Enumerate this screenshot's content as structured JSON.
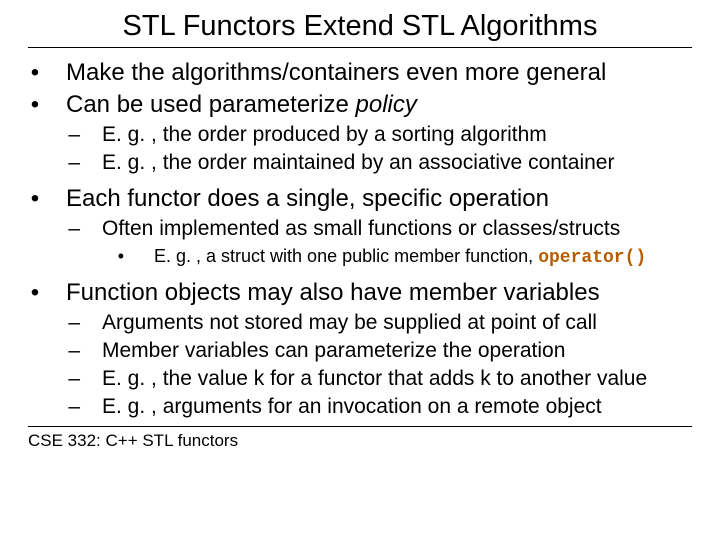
{
  "title": "STL Functors Extend STL Algorithms",
  "b1": "Make the algorithms/containers even more general",
  "b2_pre": "Can be used parameterize ",
  "b2_it": "policy",
  "b2_s1": "E. g. , the order produced by a sorting algorithm",
  "b2_s2": "E. g. , the order maintained by an associative container",
  "b3": "Each functor does a single, specific operation",
  "b3_s1": "Often implemented as small functions or classes/structs",
  "b3_s1_s1_pre": "E. g. , a struct with one public member function, ",
  "b3_s1_s1_code": "operator()",
  "b4": "Function objects may also have member variables",
  "b4_s1": "Arguments not stored may be supplied at point of call",
  "b4_s2": "Member variables can parameterize the operation",
  "b4_s3": "E. g. , the value k for a functor that adds k to another value",
  "b4_s4": "E. g. , arguments for an invocation on a remote object",
  "footer": "CSE 332: C++ STL functors",
  "bullets": {
    "dot": "•",
    "dash": "–"
  }
}
